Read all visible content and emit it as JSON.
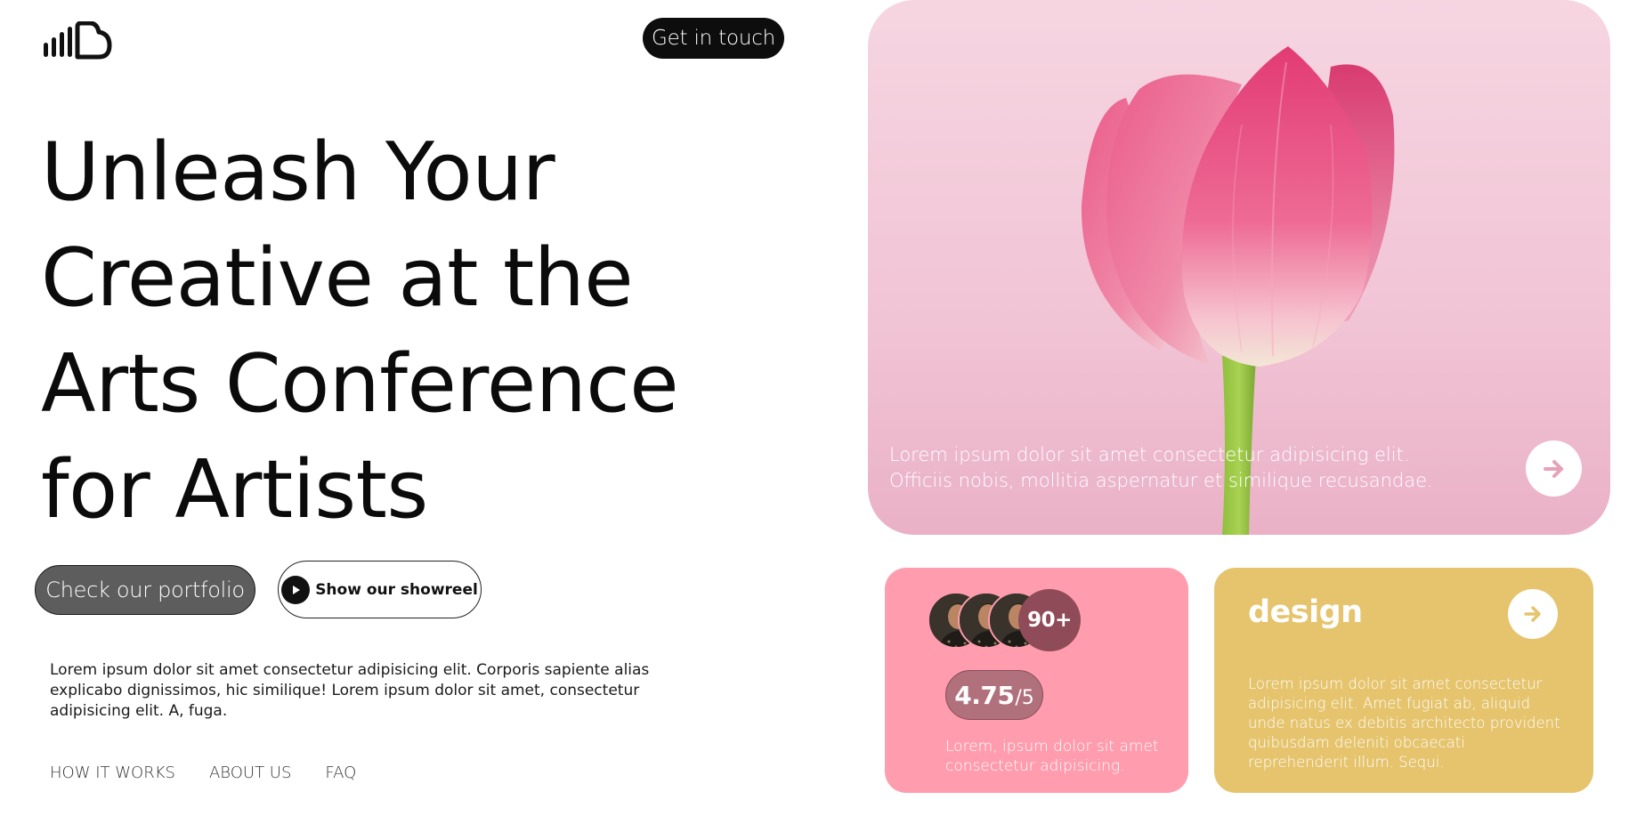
{
  "header": {
    "logo_icon": "bars-cloud-logo",
    "cta_label": "Get in touch"
  },
  "hero": {
    "title_lines": [
      "Unleash Your",
      "Creative at the",
      "Arts Conference",
      "for Artists"
    ],
    "primary_button_label": "Check our portfolio",
    "secondary_button_label": "Show our showreel",
    "secondary_button_icon": "play-icon",
    "intro_text": "Lorem ipsum dolor sit amet consectetur adipisicing elit. Corporis sapiente alias explicabo dignissimos, hic similique! Lorem ipsum dolor sit amet, consectetur adipisicing elit. A, fuga."
  },
  "footer_nav": {
    "items": [
      "HOW IT WORKS",
      "ABOUT US",
      "FAQ"
    ]
  },
  "hero_card": {
    "image": "pink-tulip-photo",
    "caption_lines": [
      "Lorem ipsum dolor sit amet consectetur adipisicing elit.",
      "Officiis nobis, mollitia aspernatur et similique recusandae."
    ],
    "arrow_icon": "arrow-right-icon"
  },
  "stats_card": {
    "avatar_count": "90+",
    "rating_value": "4.75",
    "rating_separator": "/",
    "rating_max": "5",
    "caption": "Lorem, ipsum dolor sit amet consectetur adipisicing."
  },
  "design_card": {
    "title": "design",
    "arrow_icon": "arrow-right-icon",
    "text": "Lorem ipsum dolor sit amet consectetur adipisicing elit. Amet fugiat ab, aliquid unde natus ex debitis architecto provident quibusdam deleniti obcaecati reprehenderit illum. Sequi."
  },
  "colors": {
    "black": "#0d0d0d",
    "hero_card_bg": "#f4cfdc",
    "tulip_pink": "#e8457a",
    "stats_card_bg": "#ff9cae",
    "stats_pill": "#b0707c",
    "design_card_bg": "#e5c46d",
    "portfolio_button": "#5d5d5d"
  }
}
